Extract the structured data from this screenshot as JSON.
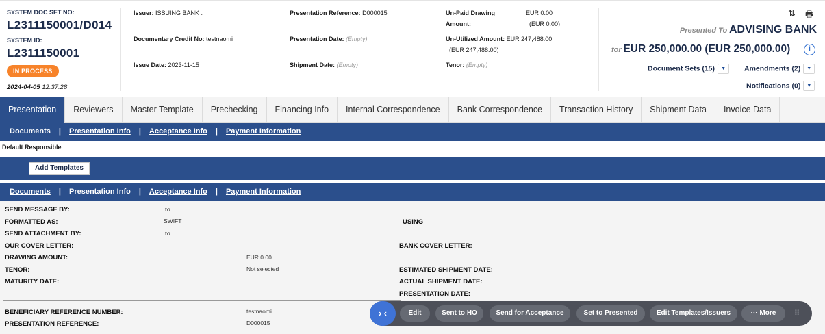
{
  "header": {
    "system_doc_set_no_label": "SYSTEM DOC SET NO:",
    "system_doc_set_no": "L2311150001/D014",
    "system_id_label": "SYSTEM ID:",
    "system_id": "L2311150001",
    "status": "IN PROCESS",
    "date": "2024-04-05",
    "time": "12:37:28",
    "issuer_label": "Issuer:",
    "issuer_value": "ISSUING BANK :",
    "dc_no_label": "Documentary Credit No:",
    "dc_no_value": "testnaomi",
    "issue_date_label": "Issue Date:",
    "issue_date_value": "2023-11-15",
    "pres_ref_label": "Presentation Reference:",
    "pres_ref_value": "D000015",
    "pres_date_label": "Presentation Date:",
    "pres_date_value": "(Empty)",
    "ship_date_label": "Shipment Date:",
    "ship_date_value": "(Empty)",
    "unpaid_label_1": "Un-Paid Drawing",
    "unpaid_label_2": "Amount:",
    "unpaid_value_1": "EUR 0.00",
    "unpaid_value_2": "(EUR 0.00)",
    "unutil_label": "Un-Utilized Amount:",
    "unutil_value_1": "EUR 247,488.00",
    "unutil_value_2": "(EUR 247,488.00)",
    "tenor_label": "Tenor:",
    "tenor_value": "(Empty)",
    "presented_to_label": "Presented To",
    "presented_to_value": "ADVISING BANK",
    "for_label": "for",
    "for_value": "EUR 250,000.00 (EUR 250,000.00)",
    "document_sets": "Document Sets (15)",
    "amendments": "Amendments (2)",
    "notifications": "Notifications (0)"
  },
  "icons": {
    "sort": "⇅",
    "print": "🖶",
    "info": "i",
    "chevron": "▼"
  },
  "tabs": [
    "Presentation",
    "Reviewers",
    "Master Template",
    "Prechecking",
    "Financing Info",
    "Internal Correspondence",
    "Bank Correspondence",
    "Transaction History",
    "Shipment Data",
    "Invoice Data"
  ],
  "subnav": {
    "documents": "Documents",
    "presentation_info": "Presentation Info",
    "acceptance_info": "Acceptance Info",
    "payment_information": "Payment Information",
    "separator": "|"
  },
  "default_responsible": "Default Responsible",
  "add_templates": "Add Templates",
  "form": {
    "send_message_by": "SEND MESSAGE BY:",
    "send_message_to": "to",
    "formatted_as": "FORMATTED AS:",
    "formatted_value": "SWIFT",
    "using": "USING",
    "send_attachment_by": "SEND ATTACHMENT BY:",
    "send_attachment_to": "to",
    "our_cover_letter": "OUR COVER LETTER:",
    "bank_cover_letter": "BANK COVER LETTER:",
    "drawing_amount": "DRAWING AMOUNT:",
    "drawing_amount_value": "EUR 0.00",
    "tenor": "TENOR:",
    "tenor_value": "Not selected",
    "estimated_shipment_date": "ESTIMATED SHIPMENT DATE:",
    "maturity_date": "MATURITY DATE:",
    "actual_shipment_date": "ACTUAL SHIPMENT DATE:",
    "presentation_date": "PRESENTATION DATE:",
    "beneficiary_ref": "BENEFICIARY REFERENCE NUMBER:",
    "beneficiary_ref_value": "testnaomi",
    "presentation_ref": "PRESENTATION REFERENCE:",
    "presentation_ref_value": "D000015"
  },
  "actions": {
    "toggle": "› ‹",
    "edit": "Edit",
    "sent_to_ho": "Sent to HO",
    "send_for_acceptance": "Send for Acceptance",
    "set_to_presented": "Set to Presented",
    "edit_templates": "Edit Templates/Issuers",
    "more": "··· More",
    "grip": "⠿"
  },
  "colors": {
    "brand_blue": "#2b4f8c",
    "status_orange": "#f7832a",
    "action_bar": "#4d5059",
    "toggle_blue": "#3f73d6"
  }
}
